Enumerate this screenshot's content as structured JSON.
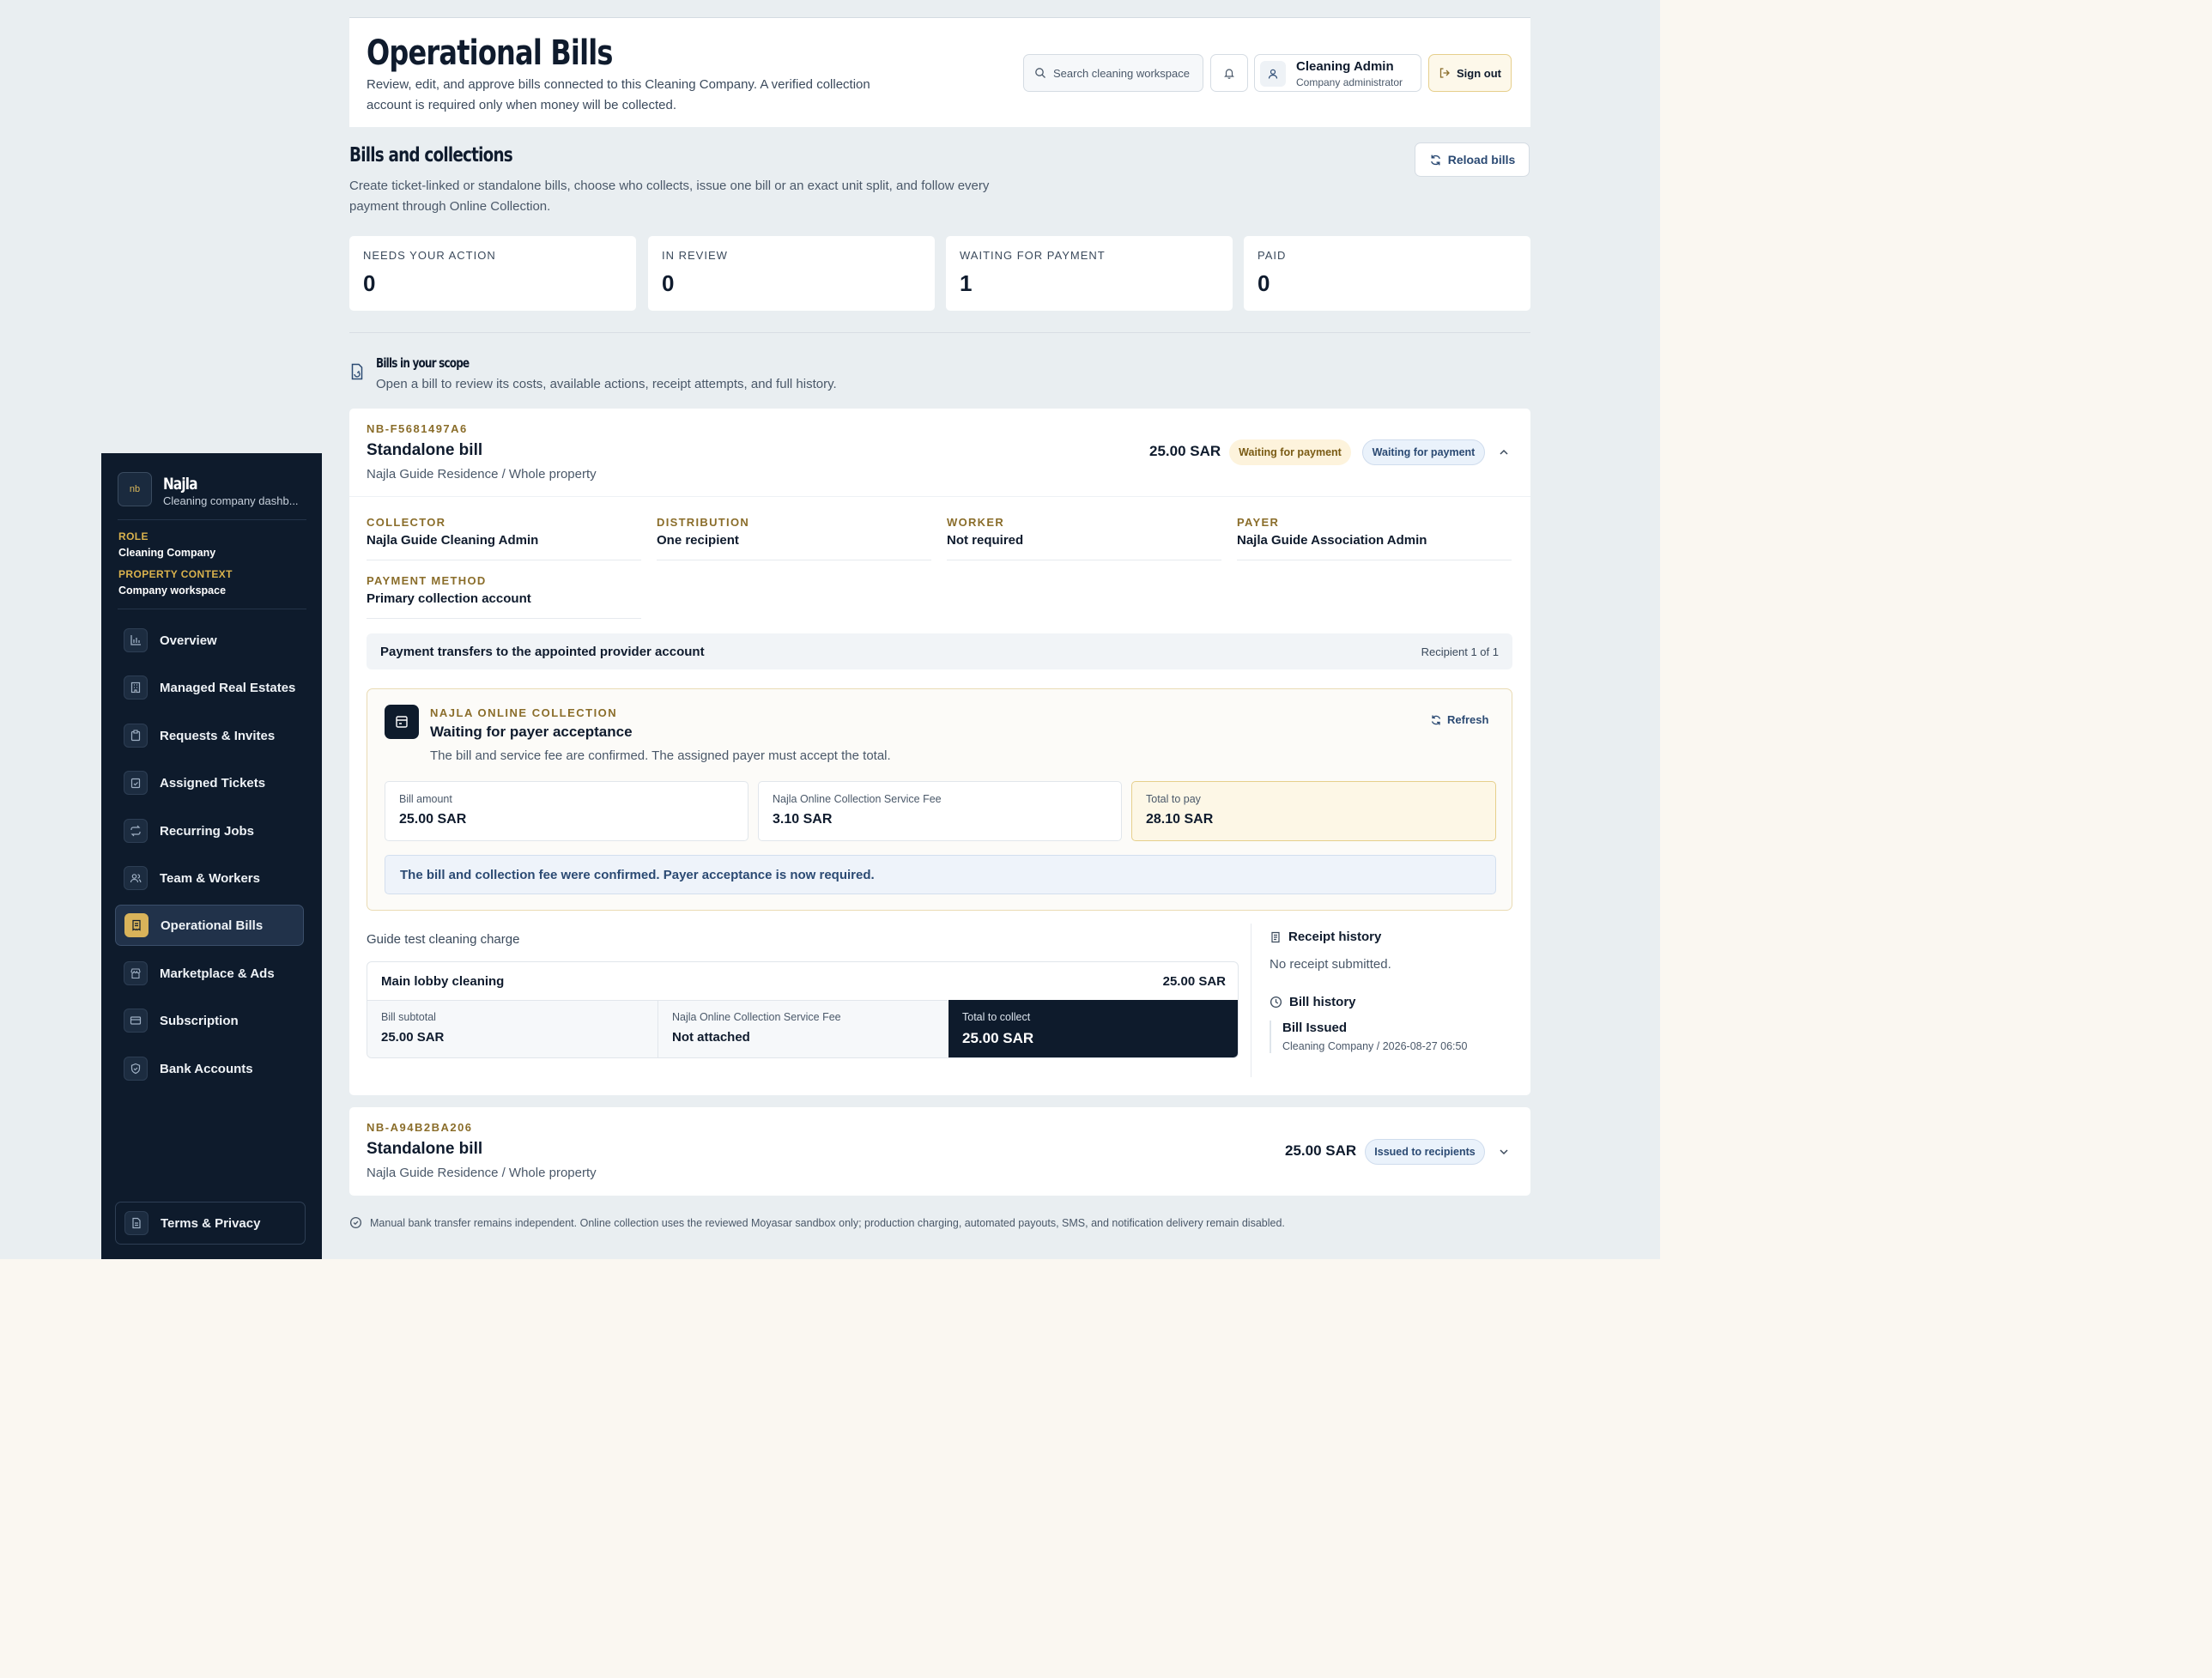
{
  "sidebar": {
    "brand": {
      "logo_text": "nb",
      "name": "Najla",
      "subtitle": "Cleaning company dashb..."
    },
    "role_label": "ROLE",
    "role_value": "Cleaning Company",
    "context_label": "PROPERTY CONTEXT",
    "context_value": "Company workspace",
    "items": [
      {
        "label": "Overview",
        "icon": "bar-chart-icon"
      },
      {
        "label": "Managed Real Estates",
        "icon": "building-icon"
      },
      {
        "label": "Requests & Invites",
        "icon": "clipboard-icon"
      },
      {
        "label": "Assigned Tickets",
        "icon": "clipboard-check-icon"
      },
      {
        "label": "Recurring Jobs",
        "icon": "repeat-icon"
      },
      {
        "label": "Team & Workers",
        "icon": "users-icon"
      },
      {
        "label": "Operational Bills",
        "icon": "receipt-icon",
        "active": true
      },
      {
        "label": "Marketplace & Ads",
        "icon": "store-icon"
      },
      {
        "label": "Subscription",
        "icon": "card-icon"
      },
      {
        "label": "Bank Accounts",
        "icon": "shield-check-icon"
      }
    ],
    "terms_label": "Terms & Privacy"
  },
  "header": {
    "title": "Operational Bills",
    "description": "Review, edit, and approve bills connected to this Cleaning Company. A verified collection account is required only when money will be collected.",
    "search_placeholder": "Search cleaning workspace",
    "user_name": "Cleaning Admin",
    "user_role": "Company administrator",
    "signout_label": "Sign out"
  },
  "section": {
    "title": "Bills and collections",
    "description": "Create ticket-linked or standalone bills, choose who collects, issue one bill or an exact unit split, and follow every payment through Online Collection.",
    "reload_label": "Reload bills"
  },
  "stats": [
    {
      "label": "NEEDS YOUR ACTION",
      "value": "0"
    },
    {
      "label": "IN REVIEW",
      "value": "0"
    },
    {
      "label": "WAITING FOR PAYMENT",
      "value": "1"
    },
    {
      "label": "PAID",
      "value": "0"
    }
  ],
  "scope": {
    "title": "Bills in your scope",
    "description": "Open a bill to review its costs, available actions, receipt attempts, and full history."
  },
  "bill1": {
    "id": "NB-F5681497A6",
    "title": "Standalone bill",
    "subtitle": "Najla Guide Residence / Whole property",
    "amount": "25.00 SAR",
    "badge_primary": "Waiting for payment",
    "badge_secondary": "Waiting for payment",
    "fields": [
      {
        "label": "COLLECTOR",
        "value": "Najla Guide Cleaning Admin"
      },
      {
        "label": "DISTRIBUTION",
        "value": "One recipient"
      },
      {
        "label": "WORKER",
        "value": "Not required"
      },
      {
        "label": "PAYER",
        "value": "Najla Guide Association Admin"
      },
      {
        "label": "PAYMENT METHOD",
        "value": "Primary collection account"
      }
    ],
    "transfer_label": "Payment transfers to the appointed provider account",
    "transfer_recipient": "Recipient 1 of 1",
    "online": {
      "tag": "NAJLA ONLINE COLLECTION",
      "title": "Waiting for payer acceptance",
      "description": "The bill and service fee are confirmed. The assigned payer must accept the total.",
      "refresh_label": "Refresh",
      "fees": [
        {
          "label": "Bill amount",
          "value": "25.00 SAR"
        },
        {
          "label": "Najla Online Collection Service Fee",
          "value": "3.10 SAR"
        },
        {
          "label": "Total to pay",
          "value": "28.10 SAR"
        }
      ],
      "confirm_message": "The bill and collection fee were confirmed. Payer acceptance is now required."
    },
    "charge_title": "Guide test cleaning charge",
    "line_item": {
      "label": "Main lobby cleaning",
      "value": "25.00 SAR"
    },
    "totals": [
      {
        "label": "Bill subtotal",
        "value": "25.00 SAR"
      },
      {
        "label": "Najla Online Collection Service Fee",
        "value": "Not attached"
      },
      {
        "label": "Total to collect",
        "value": "25.00 SAR"
      }
    ],
    "receipt_history_title": "Receipt history",
    "receipt_history_empty": "No receipt submitted.",
    "bill_history_title": "Bill history",
    "history_entry_title": "Bill Issued",
    "history_entry_sub": "Cleaning Company / 2026-08-27 06:50"
  },
  "bill2": {
    "id": "NB-A94B2BA206",
    "title": "Standalone bill",
    "subtitle": "Najla Guide Residence / Whole property",
    "amount": "25.00 SAR",
    "badge": "Issued to recipients"
  },
  "footnote": "Manual bank transfer remains independent. Online collection uses the reviewed Moyasar sandbox only; production charging, automated payouts, SMS, and notification delivery remain disabled.",
  "colors": {
    "sidebar_bg": "#0e1b2c",
    "accent_gold": "#d9b35a",
    "page_bg": "#e9eef1",
    "link_blue": "#2b4a73"
  }
}
